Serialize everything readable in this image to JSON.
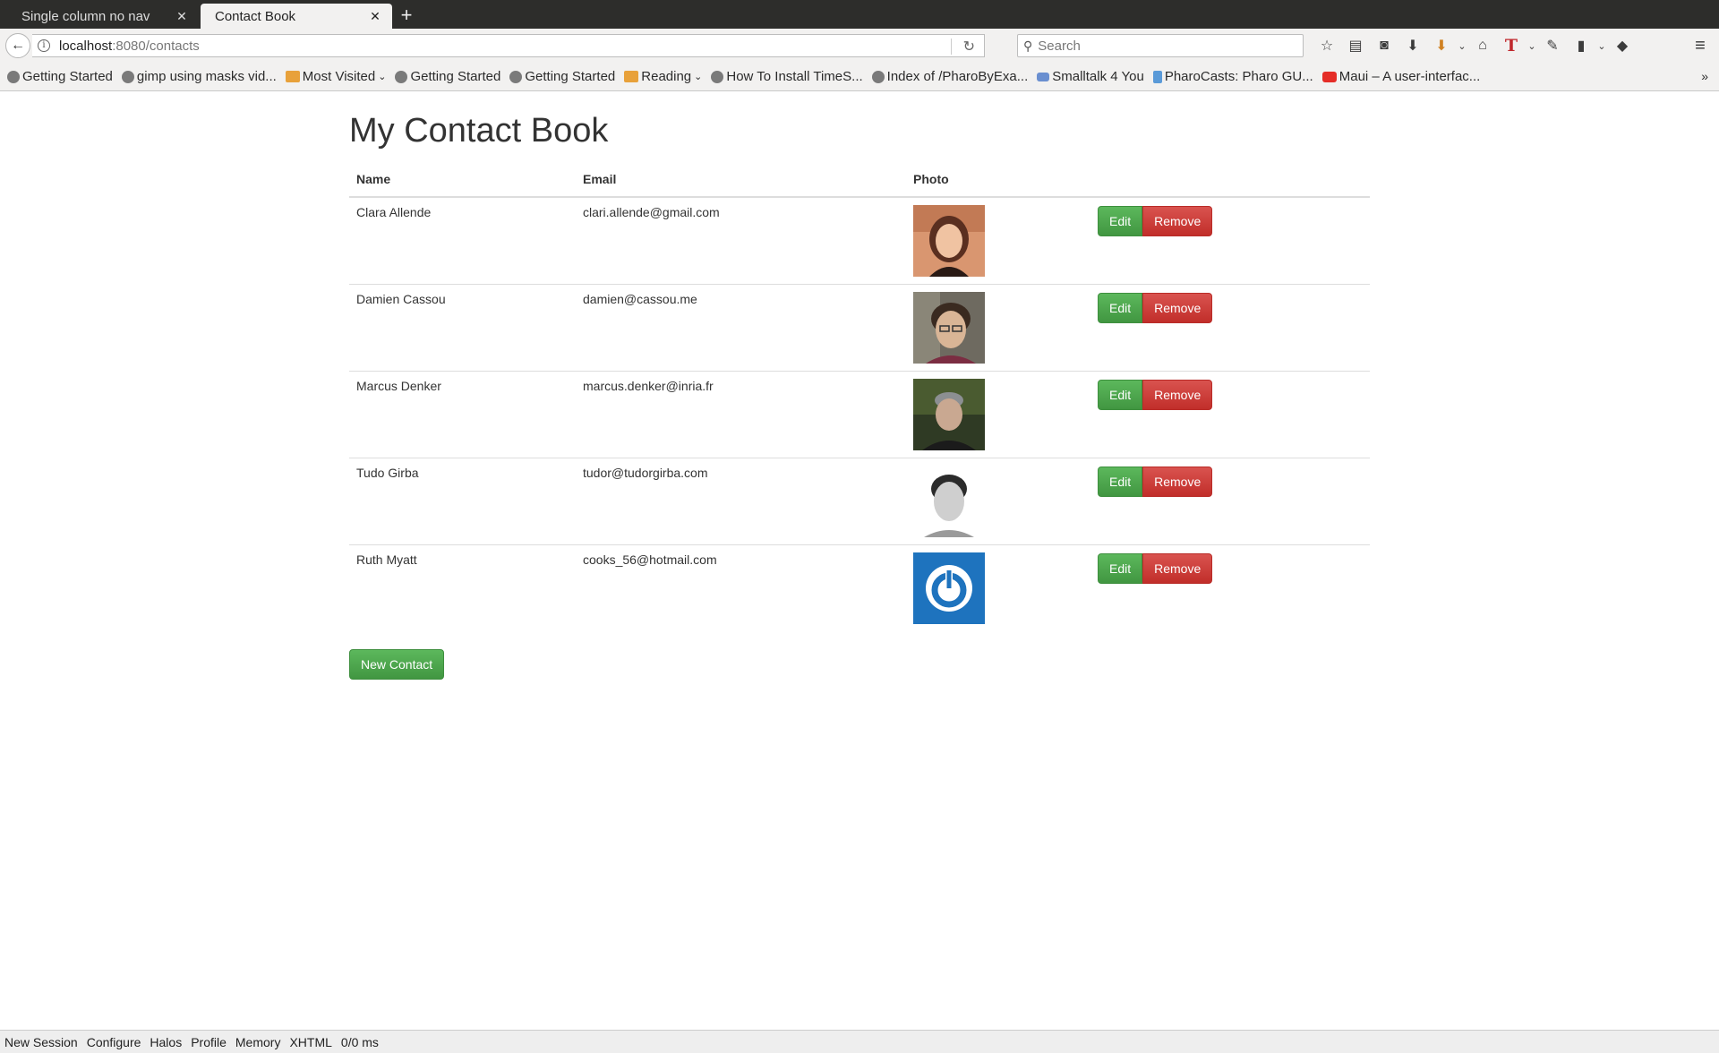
{
  "browser": {
    "tabs": [
      {
        "label": "Single column no nav",
        "active": false
      },
      {
        "label": "Contact Book",
        "active": true
      }
    ],
    "url_host": "localhost",
    "url_path": ":8080/contacts",
    "search_placeholder": "Search",
    "bookmarks": [
      {
        "label": "Getting Started",
        "icon": "globe-icon"
      },
      {
        "label": "gimp using masks vid...",
        "icon": "globe-icon"
      },
      {
        "label": "Most Visited",
        "icon": "folder-icon",
        "dropdown": true
      },
      {
        "label": "Getting Started",
        "icon": "globe-icon"
      },
      {
        "label": "Getting Started",
        "icon": "globe-icon"
      },
      {
        "label": "Reading",
        "icon": "folder-icon",
        "dropdown": true
      },
      {
        "label": "How To Install TimeS...",
        "icon": "globe-icon"
      },
      {
        "label": "Index of /PharoByExa...",
        "icon": "globe-icon"
      },
      {
        "label": "Smalltalk 4 You",
        "icon": "smalltalk-icon"
      },
      {
        "label": "PharoCasts: Pharo GU...",
        "icon": "pharocasts-icon"
      },
      {
        "label": "Maui – A user-interfac...",
        "icon": "youtube-icon"
      }
    ]
  },
  "page": {
    "title": "My Contact Book",
    "columns": {
      "name": "Name",
      "email": "Email",
      "photo": "Photo"
    },
    "contacts": [
      {
        "name": "Clara Allende",
        "email": "clari.allende@gmail.com"
      },
      {
        "name": "Damien Cassou",
        "email": "damien@cassou.me"
      },
      {
        "name": "Marcus Denker",
        "email": "marcus.denker@inria.fr"
      },
      {
        "name": "Tudo Girba",
        "email": "tudor@tudorgirba.com"
      },
      {
        "name": "Ruth Myatt",
        "email": "cooks_56@hotmail.com"
      }
    ],
    "edit_label": "Edit",
    "remove_label": "Remove",
    "new_contact_label": "New Contact"
  },
  "seaside_toolbar": [
    "New Session",
    "Configure",
    "Halos",
    "Profile",
    "Memory",
    "XHTML",
    "0/0 ms"
  ]
}
